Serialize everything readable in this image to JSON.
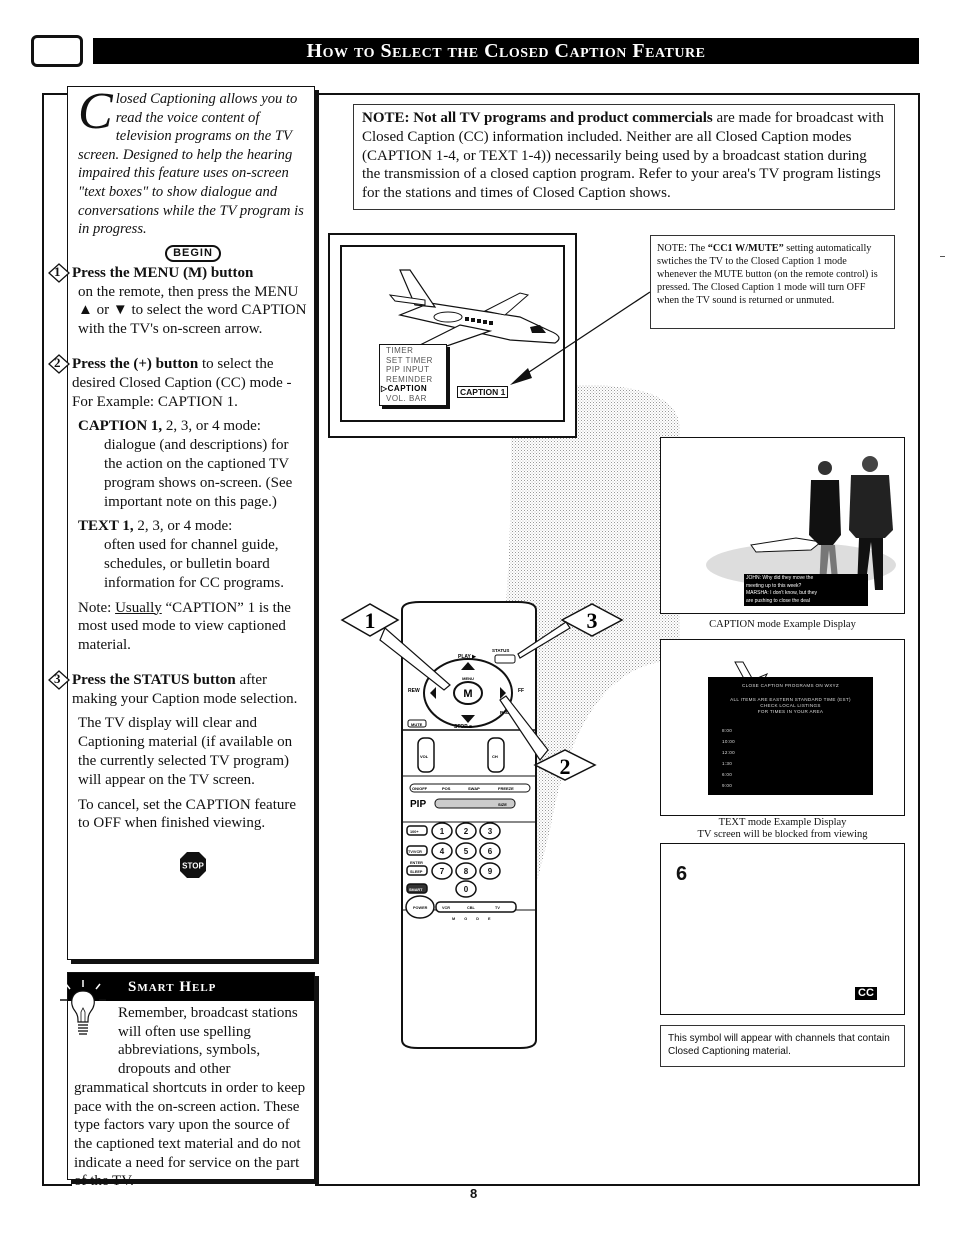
{
  "header": {
    "title": "How to Select the Closed Caption Feature"
  },
  "intro": {
    "dropcap": "C",
    "text": "losed Captioning allows you to read the voice content of television programs on the TV screen. Designed to help the hearing impaired this feature uses on-screen \"text boxes\" to show dialogue and conversations while the TV program is in progress."
  },
  "begin_label": "BEGIN",
  "steps": [
    {
      "number": "1",
      "heading": "Press the MENU (M) button",
      "body": "on the remote, then press the MENU ▲ or ▼ to select the word CAPTION with the TV's on-screen arrow."
    },
    {
      "number": "2",
      "heading": "Press the (+) button",
      "body_inline": " to select the desired Closed Caption (CC) mode - For Example: CAPTION 1.",
      "caption_mode_label": "CAPTION 1,",
      "caption_mode_rest": " 2, 3, or 4 mode:",
      "caption_mode_desc": "dialogue (and descriptions) for the action on the captioned TV program shows on-screen. (See important note on this page.)",
      "text_mode_label": "TEXT 1,",
      "text_mode_rest": " 2, 3, or 4 mode:",
      "text_mode_desc": "often used for channel guide, schedules, or bulletin board information for CC programs.",
      "note_prefix": "Note: ",
      "note_underlined": "Usually",
      "note_rest": " “CAPTION” 1 is the most used mode to view captioned material."
    },
    {
      "number": "3",
      "heading": "Press the STATUS button",
      "body_inline": " after making your Caption mode selection.",
      "para1": "The TV display will clear and Captioning material  (if available on the currently selected TV program) will appear on the TV screen.",
      "para2": "To cancel, set the CAPTION feature to OFF when finished viewing."
    }
  ],
  "stop_label": "STOP",
  "smart_help": {
    "title": "Smart Help",
    "text": "Remember, broadcast stations will often use spelling abbreviations, symbols, dropouts and other grammatical shortcuts in order to keep pace with the on-screen action. These type factors vary upon the source of the captioned text material and do not indicate a need for service on the part of the TV."
  },
  "note_top": {
    "bold": "NOTE: Not all TV programs and product commercials",
    "text": " are made for broadcast with Closed Caption (CC) information included. Neither are all Closed Caption modes (CAPTION 1-4, or TEXT 1-4)) necessarily being used by a broadcast station during the transmission of a closed caption program. Refer to your area's TV program listings for the stations and times of Closed Caption shows."
  },
  "note_mute": {
    "prefix": "NOTE: The ",
    "bold": "“CC1 W/MUTE”",
    "text": " setting automatically swtiches the TV to the Closed Caption 1 mode whenever the MUTE button (on the remote control) is pressed. The Closed Caption 1 mode will turn OFF  when the TV sound is returned or unmuted."
  },
  "tv_menu": {
    "items": [
      "TIMER",
      "SET TIMER",
      "PIP INPUT",
      "REMINDER",
      "CAPTION",
      "VOL. BAR"
    ],
    "selected_index": 4,
    "selected_value": "CAPTION 1"
  },
  "caption_example": {
    "caption_lines": [
      "JOHN: Why did they move  the",
      "meeting up to this week?",
      "MARSHA: I don't know, but they",
      "are pushing to close the deal"
    ],
    "label": "CAPTION mode Example Display"
  },
  "text_example": {
    "heading": "CLOSE CAPTION PROGRAMS ON WXYZ",
    "lines": [
      "ALL ITEMS ARE EASTERN STANDARD TIME (EST)",
      "CHECK LOCAL LISTINGS",
      "FOR TIMES IN YOUR AREA"
    ],
    "times": [
      "8:00",
      "10:00",
      "12:00",
      "1:30",
      "6:00",
      "9:00"
    ],
    "label_line1": "TEXT  mode Example Display",
    "label_line2": "TV screen will be blocked from viewing"
  },
  "cc_example": {
    "channel": "6",
    "badge": "CC",
    "note": "This symbol will appear with channels that contain Closed Captioning material."
  },
  "remote": {
    "labels": {
      "play": "PLAY ▶",
      "status": "STATUS",
      "menu": "MENU",
      "m": "M",
      "rew": "REW",
      "ff": "FF",
      "stop": "STOP ■",
      "pause": "PAUSE",
      "mute": "MUTE",
      "vol": "VOL",
      "ch": "CH",
      "on_off": "ON/OFF",
      "pos": "POS",
      "swap": "SWAP",
      "freeze": "FREEZE",
      "pip": "PIP",
      "size": "SIZE",
      "hundred": "100+",
      "tv_vcr": "TV/VCR",
      "enter": "ENTER",
      "sleep": "SLEEP",
      "smart": "SMART",
      "power": "POWER",
      "vcr": "VCR",
      "cbl": "CBL",
      "tv": "TV",
      "mode": "M O D E"
    },
    "digits": [
      "1",
      "2",
      "3",
      "4",
      "5",
      "6",
      "7",
      "8",
      "9",
      "0"
    ],
    "callouts": [
      "1",
      "2",
      "3"
    ]
  },
  "page_number": "8"
}
